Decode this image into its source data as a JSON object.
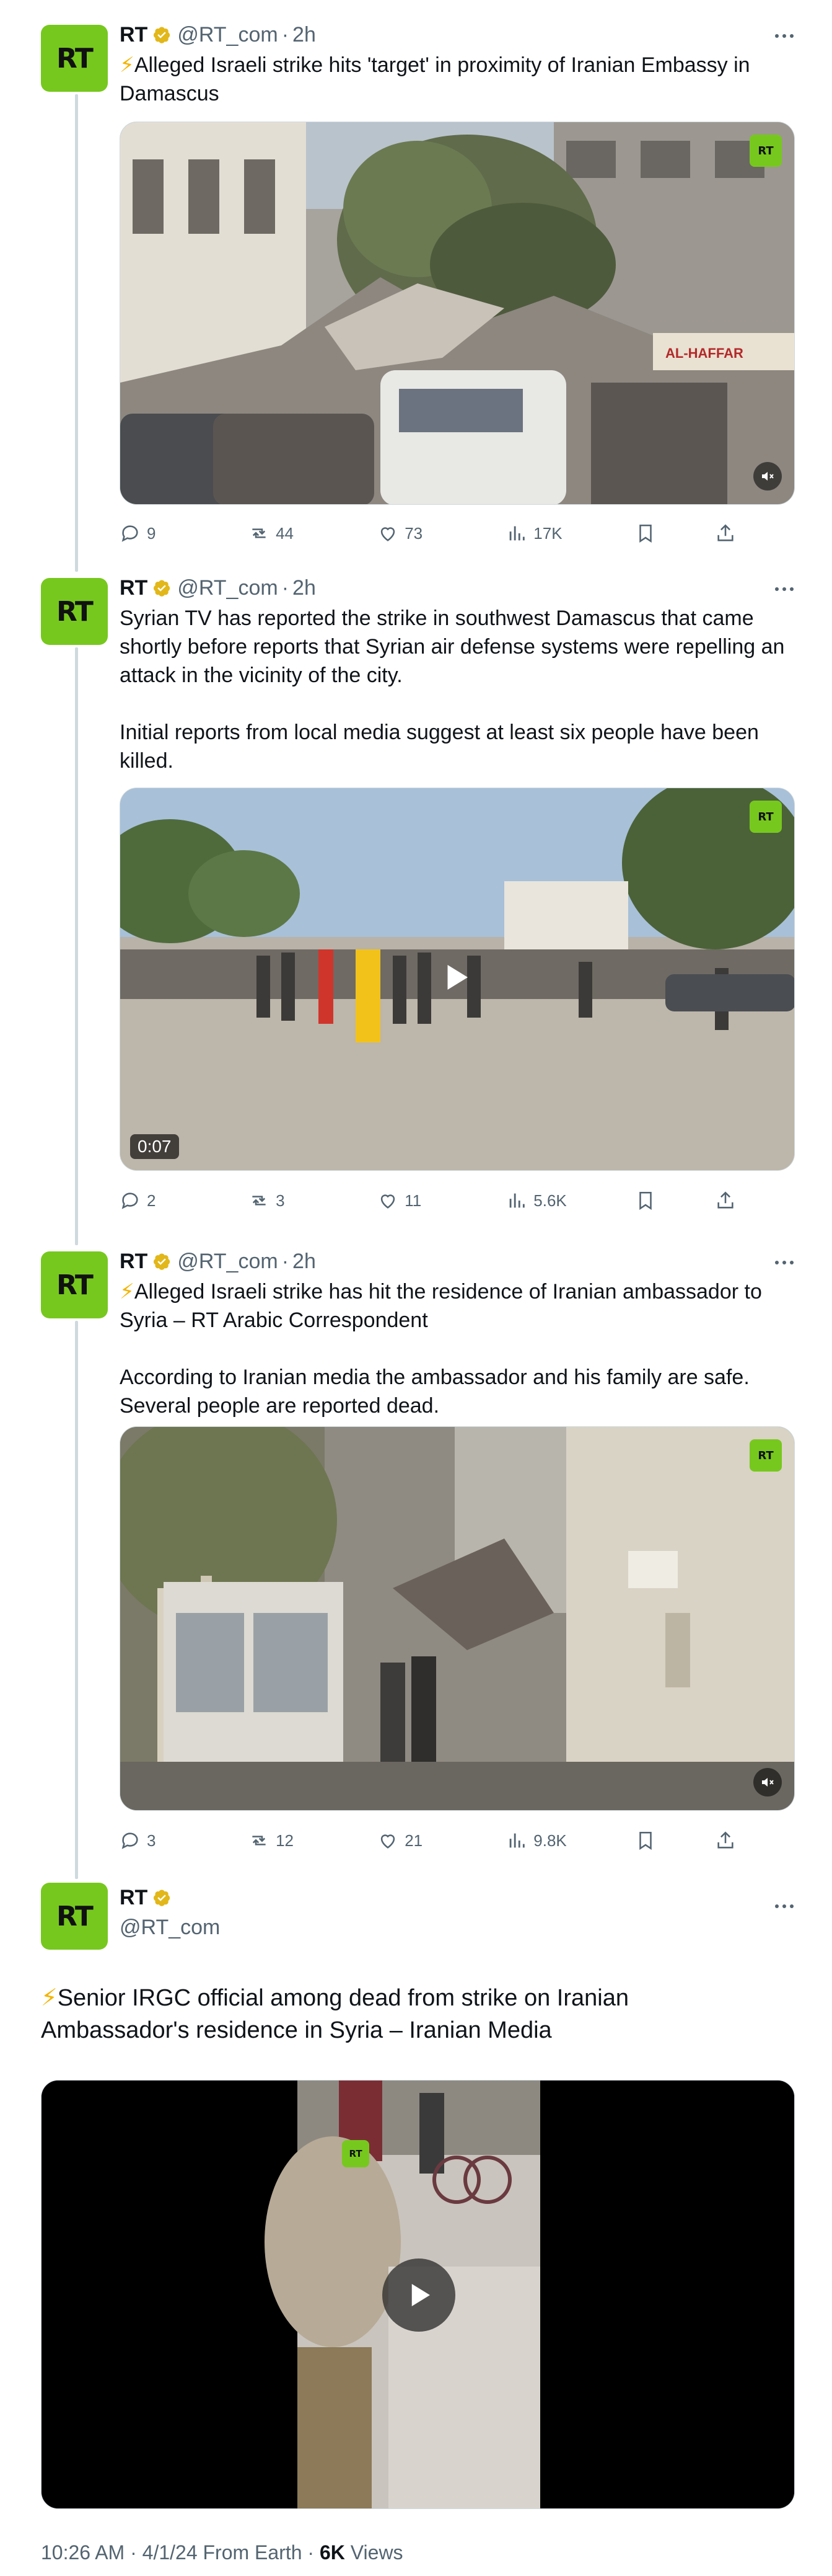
{
  "account": {
    "name": "RT",
    "handle": "@RT_com",
    "avatar_text": "RT",
    "badge_text": "RT"
  },
  "tweets": [
    {
      "time": "2h",
      "text": "Alleged Israeli strike hits 'target' in proximity of Iranian Embassy in Damascus",
      "bolt": "⚡",
      "media": {
        "kind": "image",
        "sign_text": "AL-HAFFAR",
        "description_icon": "mute-icon"
      },
      "replies": "9",
      "reposts": "44",
      "likes": "73",
      "views": "17K"
    },
    {
      "time": "2h",
      "text": "Syrian TV has reported the strike in southwest Damascus that came shortly before reports that Syrian air defense systems were repelling an attack in the vicinity of the city.\n\nInitial reports from local media suggest at least six people have been killed.",
      "media": {
        "kind": "video",
        "duration": "0:07"
      },
      "replies": "2",
      "reposts": "3",
      "likes": "11",
      "views": "5.6K"
    },
    {
      "time": "2h",
      "text": "Alleged Israeli strike has hit the residence of Iranian ambassador to Syria – RT Arabic Correspondent\n\nAccording to Iranian media the ambassador and his family are safe. Several people are reported dead.",
      "bolt": "⚡",
      "media": {
        "kind": "image"
      },
      "replies": "3",
      "reposts": "12",
      "likes": "21",
      "views": "9.8K"
    }
  ],
  "main_tweet": {
    "text": "Senior IRGC official among dead from strike on Iranian Ambassador's residence in Syria – Iranian Media",
    "bolt": "⚡",
    "media": {
      "kind": "video"
    },
    "timestamp": "10:26 AM · 4/1/24 From Earth · ",
    "views_count": "6K",
    "views_label": " Views"
  },
  "colors": {
    "brand_green": "#77c81e",
    "verified_gold": "#e2b719",
    "muted_text": "#536471",
    "thread_line": "#cfd9de"
  }
}
